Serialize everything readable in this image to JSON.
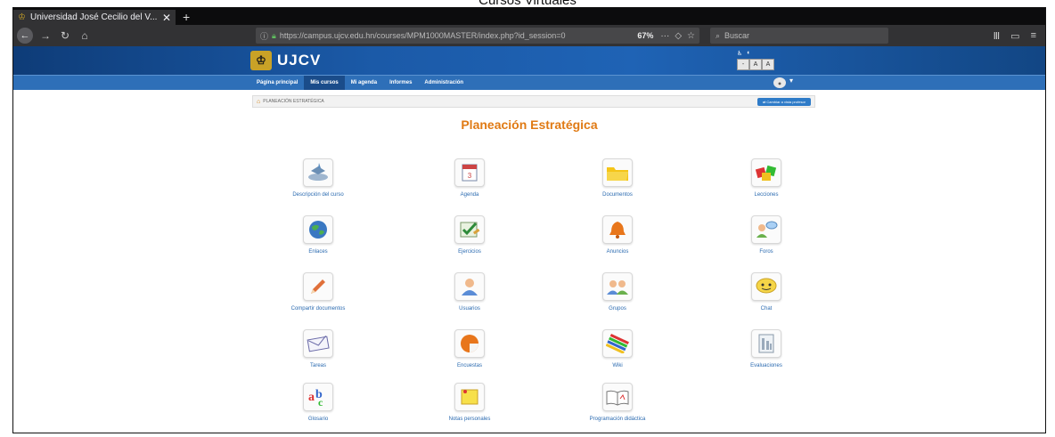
{
  "caption": "Cursos Virtuales",
  "browser": {
    "tab_title": "Universidad José Cecilio del V...",
    "tab_close": "✕",
    "new_tab": "+",
    "url": "https://campus.ujcv.edu.hn/courses/MPM1000MASTER/index.php?id_session=0",
    "zoom": "67%",
    "search_placeholder": "Buscar"
  },
  "site": {
    "logo_text": "UJCV",
    "font_controls": [
      "-",
      "A",
      "A"
    ]
  },
  "menu": [
    "Página principal",
    "Mis cursos",
    "Mi agenda",
    "Informes",
    "Administración"
  ],
  "menu_active_index": 1,
  "breadcrumb": "PLANEACIÓN ESTRATÉGICA",
  "role_button": "Cambiar a vista profesor",
  "course_title": "Planeación Estratégica",
  "tools": [
    {
      "label": "Descripción del curso",
      "icon": "course-description-icon"
    },
    {
      "label": "Agenda",
      "icon": "calendar-icon"
    },
    {
      "label": "Documentos",
      "icon": "folder-icon"
    },
    {
      "label": "Lecciones",
      "icon": "cubes-icon"
    },
    {
      "label": "Enlaces",
      "icon": "globe-icon"
    },
    {
      "label": "Ejercicios",
      "icon": "exercise-icon"
    },
    {
      "label": "Anuncios",
      "icon": "bell-icon"
    },
    {
      "label": "Foros",
      "icon": "forum-icon"
    },
    {
      "label": "Compartir documentos",
      "icon": "pencil-icon"
    },
    {
      "label": "Usuarios",
      "icon": "user-icon"
    },
    {
      "label": "Grupos",
      "icon": "group-icon"
    },
    {
      "label": "Chat",
      "icon": "chat-icon"
    },
    {
      "label": "Tareas",
      "icon": "envelope-icon"
    },
    {
      "label": "Encuestas",
      "icon": "survey-icon"
    },
    {
      "label": "Wiki",
      "icon": "wiki-icon"
    },
    {
      "label": "Evaluaciones",
      "icon": "evaluation-icon"
    },
    {
      "label": "Glosario",
      "icon": "glossary-icon"
    },
    {
      "label": "Notas personales",
      "icon": "note-icon"
    },
    {
      "label": "Programación didáctica",
      "icon": "book-icon"
    }
  ],
  "colors": {
    "accent": "#e07a14",
    "menu": "#2e6fb8",
    "link": "#2a6ab0"
  }
}
